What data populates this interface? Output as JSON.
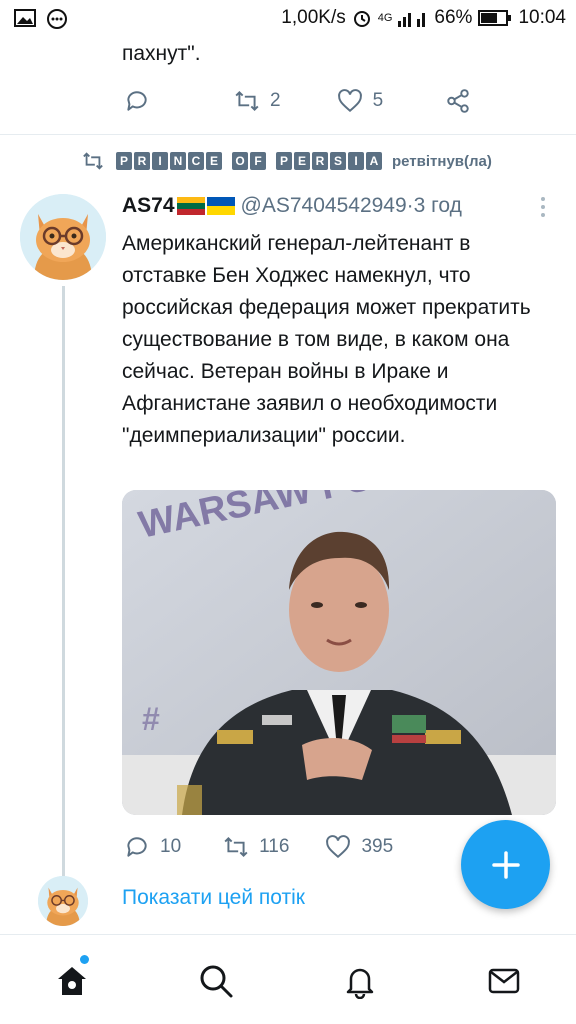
{
  "status_bar": {
    "speed": "1,00K/s",
    "network": "4G",
    "battery": "66%",
    "time": "10:04"
  },
  "prev_tweet": {
    "text_tail": "пахнут\".",
    "retweets": "2",
    "likes": "5"
  },
  "retweet_context": {
    "retweeter_letters": [
      "P",
      "R",
      "I",
      "N",
      "C",
      "E",
      " ",
      "O",
      "F",
      " ",
      "P",
      "E",
      "R",
      "S",
      "I",
      "A"
    ],
    "suffix": "ретвітнув(ла)"
  },
  "tweet": {
    "display_name": "AS74",
    "flags": [
      "lithuania-flag",
      "ukraine-flag"
    ],
    "handle": "@AS7404542949",
    "separator": " · ",
    "time": "3 год",
    "text": "Американский генерал-лейтенант в отставке Бен Ходжес намекнул, что российская федерация может прекратить существование в том виде, в каком она сейчас. Ветеран войны в Ираке и Афганистане заявил о необходимости \"деимпериализации\" россии.",
    "media_background_text": "WARSAW FORUM",
    "replies": "10",
    "retweets": "116",
    "likes": "395"
  },
  "show_thread": "Показати цей потік",
  "colors": {
    "accent": "#1da1f2",
    "secondary_text": "#5b7083",
    "lithuania": [
      "#fdb913",
      "#006a44",
      "#c1272d"
    ],
    "ukraine": [
      "#0057b7",
      "#ffd700"
    ]
  },
  "nav": [
    "home-icon",
    "search-icon",
    "notifications-icon",
    "messages-icon"
  ]
}
